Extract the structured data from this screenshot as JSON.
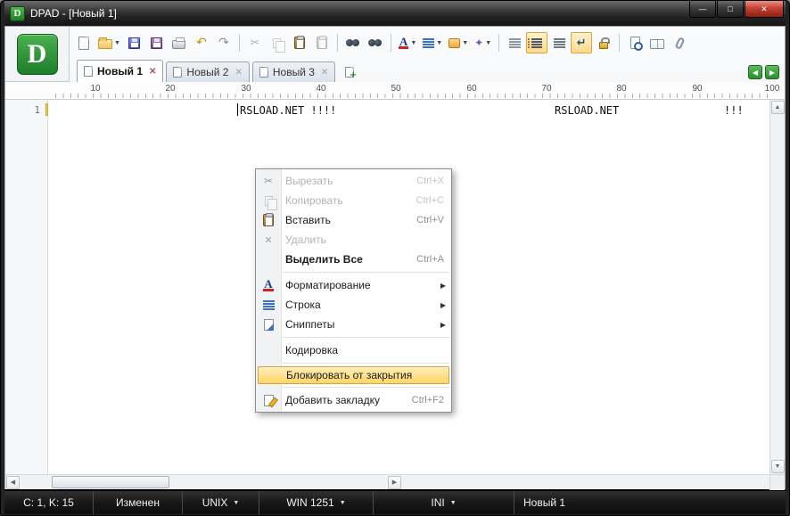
{
  "window": {
    "title": "DPAD - [Новый 1]",
    "logo_letter": "D"
  },
  "glyphs": {
    "minimize": "—",
    "maximize": "□",
    "close": "✕",
    "dropdown": "▼",
    "submenu": "▶",
    "tab_close": "✕",
    "nav_left": "◀",
    "nav_right": "▶",
    "undo": "↶",
    "redo": "↷",
    "cut": "✂",
    "wrap": "↵",
    "magic": "✦",
    "delete": "✕",
    "scroll_up": "▲",
    "scroll_down": "▼",
    "scroll_left": "◀",
    "scroll_right": "▶",
    "plus": "+"
  },
  "toolbar": {
    "items": [
      {
        "name": "new-document",
        "state": "normal"
      },
      {
        "name": "open",
        "state": "normal",
        "dropdown": true
      },
      {
        "name": "save",
        "state": "normal"
      },
      {
        "name": "save-all",
        "state": "normal"
      },
      {
        "name": "print",
        "state": "normal"
      },
      {
        "name": "undo",
        "state": "normal"
      },
      {
        "name": "redo",
        "state": "disabled"
      },
      {
        "name": "cut",
        "state": "disabled"
      },
      {
        "name": "copy",
        "state": "disabled"
      },
      {
        "name": "paste",
        "state": "normal"
      },
      {
        "name": "paste-special",
        "state": "disabled"
      },
      {
        "name": "find",
        "state": "normal"
      },
      {
        "name": "replace",
        "state": "normal"
      },
      {
        "name": "font-color",
        "state": "normal",
        "dropdown": true
      },
      {
        "name": "alignment",
        "state": "normal",
        "dropdown": true
      },
      {
        "name": "insert",
        "state": "normal",
        "dropdown": true
      },
      {
        "name": "tools",
        "state": "normal",
        "dropdown": true
      },
      {
        "name": "indent-marks",
        "state": "normal"
      },
      {
        "name": "line-numbers",
        "state": "active"
      },
      {
        "name": "special-symbols",
        "state": "normal"
      },
      {
        "name": "word-wrap",
        "state": "active"
      },
      {
        "name": "lock",
        "state": "normal"
      },
      {
        "name": "preview",
        "state": "normal"
      },
      {
        "name": "help-book",
        "state": "normal"
      },
      {
        "name": "attachments",
        "state": "normal"
      }
    ]
  },
  "tabs": {
    "items": [
      {
        "label": "Новый 1",
        "active": true
      },
      {
        "label": "Новый 2",
        "active": false
      },
      {
        "label": "Новый 3",
        "active": false
      }
    ]
  },
  "ruler": {
    "marks": [
      "10",
      "20",
      "30",
      "40",
      "50",
      "60",
      "70",
      "80",
      "90",
      "100"
    ]
  },
  "editor": {
    "line_number": "1",
    "segments": [
      "RSLOAD.NET !!!!",
      "RSLOAD.NET",
      "!!!"
    ]
  },
  "context_menu": {
    "items": [
      {
        "label": "Вырезать",
        "shortcut": "Ctrl+X",
        "state": "disabled"
      },
      {
        "label": "Копировать",
        "shortcut": "Ctrl+C",
        "state": "disabled"
      },
      {
        "label": "Вставить",
        "shortcut": "Ctrl+V",
        "state": "normal"
      },
      {
        "label": "Удалить",
        "shortcut": "",
        "state": "disabled"
      },
      {
        "label": "Выделить Все",
        "shortcut": "Ctrl+A",
        "state": "normal"
      },
      {
        "label": "Форматирование",
        "submenu": true,
        "state": "normal"
      },
      {
        "label": "Строка",
        "submenu": true,
        "state": "normal"
      },
      {
        "label": "Сниппеты",
        "submenu": true,
        "state": "normal"
      },
      {
        "label": "Кодировка",
        "state": "normal"
      },
      {
        "label": "Блокировать от закрытия",
        "state": "highlighted"
      },
      {
        "label": "Добавить закладку",
        "shortcut": "Ctrl+F2",
        "state": "normal"
      }
    ]
  },
  "status_bar": {
    "items": [
      {
        "label": "C: 1, K: 15"
      },
      {
        "label": "Изменен"
      },
      {
        "label": "UNIX",
        "dropdown": true
      },
      {
        "label": "WIN 1251",
        "dropdown": true
      },
      {
        "label": "INI",
        "dropdown": true
      },
      {
        "label": "Новый 1"
      }
    ]
  },
  "colors": {
    "highlight_orange": "#ffd666",
    "active_button_orange": "#ffd98d",
    "logo_green": "#2c9a33",
    "close_red": "#c44233",
    "status_bg": "#161616"
  }
}
